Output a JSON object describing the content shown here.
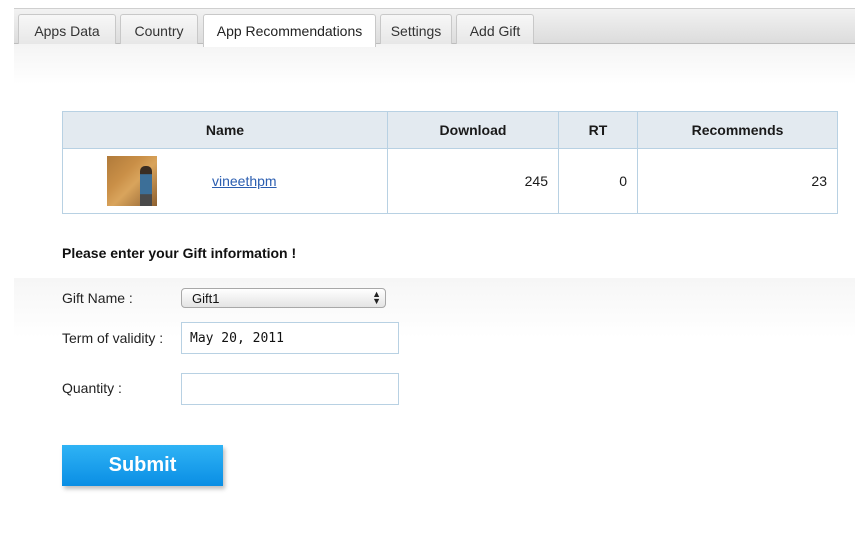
{
  "tabs": [
    {
      "label": "Apps Data",
      "active": false
    },
    {
      "label": "Country",
      "active": false
    },
    {
      "label": "App Recommendations",
      "active": true
    },
    {
      "label": "Settings",
      "active": false
    },
    {
      "label": "Add Gift",
      "active": false
    }
  ],
  "table": {
    "headers": [
      "Name",
      "Download",
      "RT",
      "Recommends"
    ],
    "rows": [
      {
        "name": "vineethpm",
        "download": "245",
        "rt": "0",
        "recommends": "23",
        "avatar": "user-photo"
      }
    ]
  },
  "gift_form": {
    "heading": "Please enter your Gift information !",
    "gift_name_label": "Gift Name :",
    "gift_name_value": "Gift1",
    "validity_label": "Term of validity :",
    "validity_value": "May 20, 2011",
    "quantity_label": "Quantity :",
    "quantity_value": "",
    "submit_label": "Submit"
  },
  "colors": {
    "submit_button": "#1a9ff0",
    "table_header_bg": "#e3eaf0",
    "table_border": "#b8d1e3",
    "link": "#2a5db0"
  }
}
